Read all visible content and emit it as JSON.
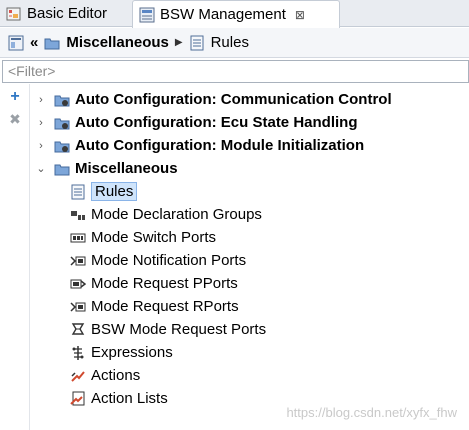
{
  "tabs": [
    {
      "label": "Basic Editor"
    },
    {
      "label": "BSW Management",
      "close": "⊠"
    }
  ],
  "breadcrumb": {
    "back": "«",
    "item1": "Miscellaneous",
    "separator": "▶",
    "item2": "Rules"
  },
  "filter": {
    "placeholder": "<Filter>"
  },
  "tools": {
    "add": "+",
    "delete": "✖"
  },
  "tree": {
    "top": [
      {
        "label": "Auto Configuration: Communication Control",
        "twisty": "›"
      },
      {
        "label": "Auto Configuration: Ecu State Handling",
        "twisty": "›"
      },
      {
        "label": "Auto Configuration: Module Initialization",
        "twisty": "›"
      },
      {
        "label": "Miscellaneous",
        "twisty": "⌄"
      }
    ],
    "children": [
      {
        "label": "Rules"
      },
      {
        "label": "Mode Declaration Groups"
      },
      {
        "label": "Mode Switch Ports"
      },
      {
        "label": "Mode Notification Ports"
      },
      {
        "label": "Mode Request PPorts"
      },
      {
        "label": "Mode Request RPorts"
      },
      {
        "label": "BSW Mode Request Ports"
      },
      {
        "label": "Expressions"
      },
      {
        "label": "Actions"
      },
      {
        "label": "Action Lists"
      }
    ]
  },
  "watermark": "https://blog.csdn.net/xyfx_fhw"
}
